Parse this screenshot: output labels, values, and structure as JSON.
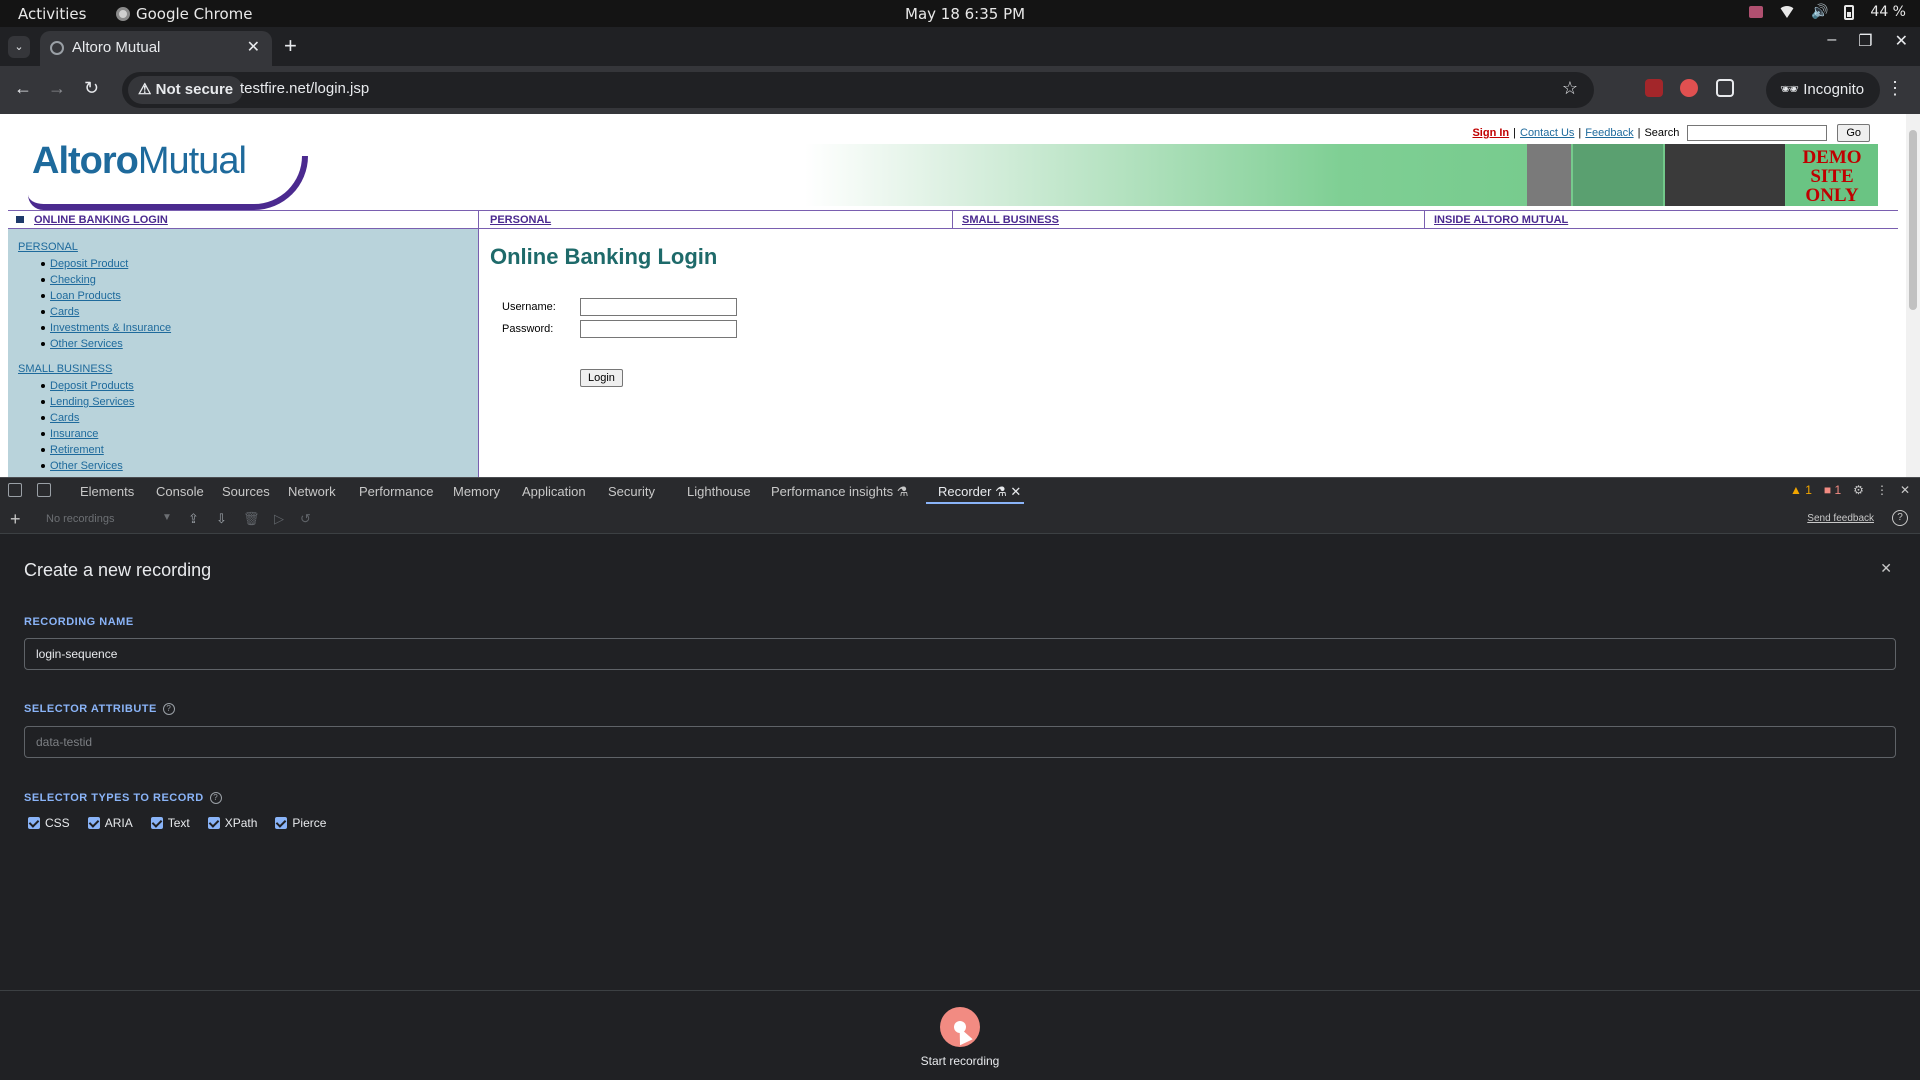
{
  "os": {
    "activities": "Activities",
    "app_name": "Google Chrome",
    "clock": "May 18  6:35 PM",
    "battery": "44 %"
  },
  "browser": {
    "tab_title": "Altoro Mutual",
    "security_label": "Not secure",
    "url": "testfire.net/login.jsp",
    "incognito_label": "Incognito"
  },
  "site": {
    "logo_strong": "Altoro",
    "logo_light": "Mutual",
    "top_links": {
      "sign_in": "Sign In",
      "contact": "Contact Us",
      "feedback": "Feedback",
      "search_label": "Search",
      "go": "Go"
    },
    "banner_text": [
      "DEMO",
      "SITE",
      "ONLY"
    ],
    "nav": [
      "ONLINE BANKING LOGIN",
      "PERSONAL",
      "SMALL BUSINESS",
      "INSIDE ALTORO MUTUAL"
    ],
    "sidebar": {
      "personal_title": "PERSONAL",
      "personal_items": [
        "Deposit Product",
        "Checking",
        "Loan Products",
        "Cards",
        "Investments & Insurance",
        "Other Services"
      ],
      "small_business_title": "SMALL BUSINESS",
      "small_business_items": [
        "Deposit Products",
        "Lending Services",
        "Cards",
        "Insurance",
        "Retirement",
        "Other Services"
      ]
    },
    "login": {
      "heading": "Online Banking Login",
      "username_label": "Username:",
      "password_label": "Password:",
      "login_button": "Login"
    }
  },
  "devtools": {
    "tabs": [
      "Elements",
      "Console",
      "Sources",
      "Network",
      "Performance",
      "Memory",
      "Application",
      "Security",
      "Lighthouse",
      "Performance insights",
      "Recorder"
    ],
    "active_tab": "Recorder",
    "warnings": "1",
    "errors": "1",
    "recordings_select": "No recordings",
    "send_feedback": "Send feedback"
  },
  "recorder": {
    "title": "Create a new recording",
    "recording_name_label": "RECORDING NAME",
    "recording_name_value": "login-sequence",
    "selector_attribute_label": "SELECTOR ATTRIBUTE",
    "selector_attribute_placeholder": "data-testid",
    "selector_types_label": "SELECTOR TYPES TO RECORD",
    "selector_types": [
      {
        "label": "CSS",
        "checked": true
      },
      {
        "label": "ARIA",
        "checked": true
      },
      {
        "label": "Text",
        "checked": true
      },
      {
        "label": "XPath",
        "checked": true
      },
      {
        "label": "Pierce",
        "checked": true
      }
    ],
    "start_label": "Start recording",
    "accent_color": "#8ab4f8",
    "record_color": "#f28b82"
  }
}
